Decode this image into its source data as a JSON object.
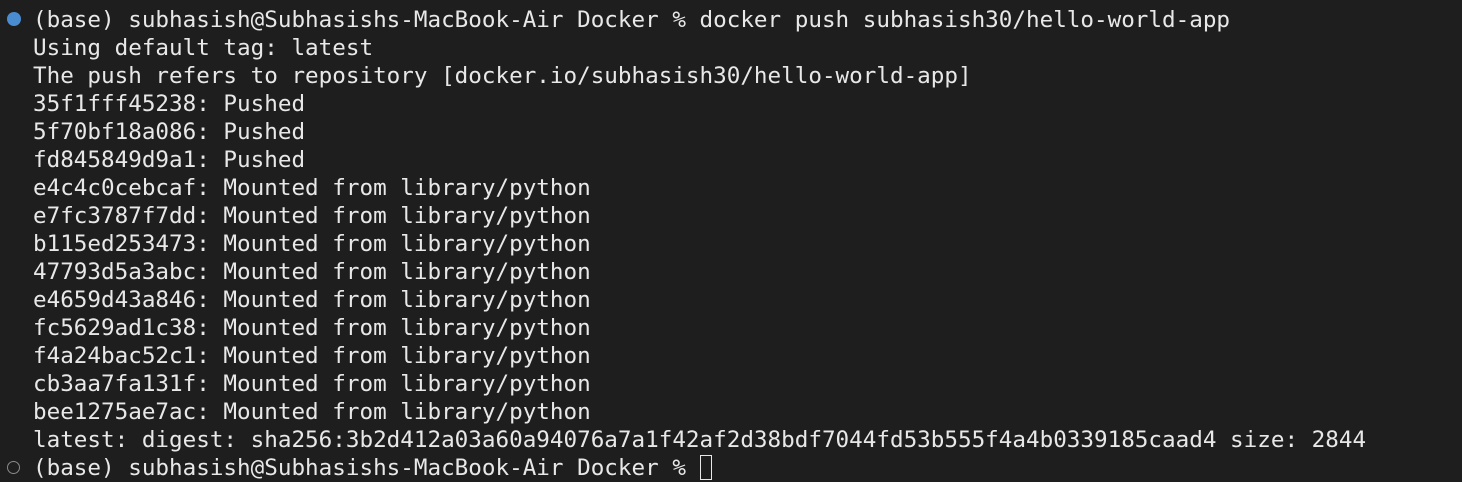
{
  "colors": {
    "background": "#1e1e1e",
    "text": "#e8e8e8",
    "success_marker": "#4a8cd0",
    "pending_marker": "#8a8a8a"
  },
  "terminal": {
    "command_prompt": "(base) subhasish@Subhasishs-MacBook-Air Docker % docker push subhasish30/hello-world-app",
    "output_lines": [
      "Using default tag: latest",
      "The push refers to repository [docker.io/subhasish30/hello-world-app]",
      "35f1fff45238: Pushed",
      "5f70bf18a086: Pushed",
      "fd845849d9a1: Pushed",
      "e4c4c0cebcaf: Mounted from library/python",
      "e7fc3787f7dd: Mounted from library/python",
      "b115ed253473: Mounted from library/python",
      "47793d5a3abc: Mounted from library/python",
      "e4659d43a846: Mounted from library/python",
      "fc5629ad1c38: Mounted from library/python",
      "f4a24bac52c1: Mounted from library/python",
      "cb3aa7fa131f: Mounted from library/python",
      "bee1275ae7ac: Mounted from library/python",
      "latest: digest: sha256:3b2d412a03a60a94076a7a1f42af2d38bdf7044fd53b555f4a4b0339185caad4 size: 2844"
    ],
    "current_prompt": "(base) subhasish@Subhasishs-MacBook-Air Docker % "
  }
}
